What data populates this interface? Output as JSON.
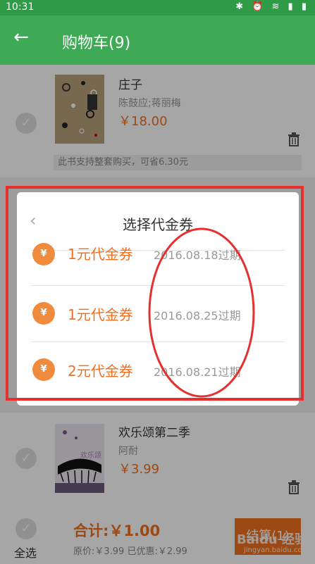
{
  "status_bar": {
    "time": "10:31",
    "icons": "✱ ⏰ ≋ ▮ ▮"
  },
  "app_bar": {
    "back_icon": "←",
    "title": "购物车(9)"
  },
  "cart_items": [
    {
      "check": "✓",
      "name": "庄子",
      "author": "陈鼓应;蒋丽梅",
      "price": "￥18.00",
      "promo": "此书支持整套购买，可省6.30元"
    },
    {
      "check": "✓",
      "name": "欢乐颂第二季",
      "author": "阿耐",
      "price": "￥3.99",
      "cover_text": "欢乐颂"
    }
  ],
  "bottom_bar": {
    "select_all_check": "✓",
    "select_all": "全选",
    "total": "合计:￥1.00",
    "subprice": "原价:￥3.99  已优惠:￥2.99",
    "checkout": "结算(1)",
    "watermark": "Baidu 经验",
    "watermark_url": "jingyan.baidu.com"
  },
  "dialog": {
    "back_icon": "‹",
    "title": "选择代金券",
    "coupons": [
      {
        "icon": "¥",
        "name": "1元代金券",
        "expiry": "2016.08.18过期"
      },
      {
        "icon": "¥",
        "name": "1元代金券",
        "expiry": "2016.08.25过期"
      },
      {
        "icon": "¥",
        "name": "2元代金券",
        "expiry": "2016.08.21过期"
      }
    ]
  },
  "colors": {
    "app_bar": "#3eaa55",
    "accent": "#f07020",
    "annotation": "#e63030"
  }
}
